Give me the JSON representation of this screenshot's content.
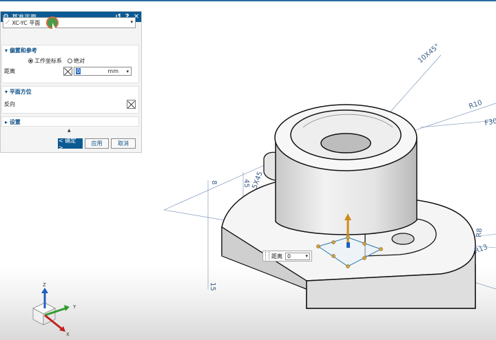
{
  "dialog": {
    "title": "基准平面",
    "title_buttons": [
      "↺",
      "?",
      "✕"
    ],
    "type_value": "XC-YC 平面",
    "sections": {
      "offset": {
        "header": "偏置和参考",
        "radio_wcs": "工作坐标系",
        "radio_abs": "绝对",
        "distance_label": "距离",
        "distance_value": "0",
        "distance_unit": "mm"
      },
      "orientation": {
        "header": "平面方位",
        "reverse_label": "反向"
      },
      "settings": {
        "header": "设置"
      }
    },
    "buttons": {
      "ok": "< 确定 >",
      "apply": "应用",
      "cancel": "取消"
    }
  },
  "floating": {
    "label": "距离",
    "value": "0"
  },
  "dimensions": {
    "chamfer": "10X45°",
    "r10": "R10",
    "f30": "F30",
    "d5": "5X45",
    "n8": "8",
    "n45": "45",
    "r8": "R8",
    "r13": "R13",
    "n15": "15"
  },
  "axes": {
    "z": "Z",
    "y": "Y",
    "x": "X"
  },
  "colors": {
    "title_bar": "#0c5a93",
    "accent": "#2b6aa3",
    "axis_z": "#1f5fbf",
    "axis_y": "#2e9b2e",
    "axis_x": "#c02020"
  }
}
